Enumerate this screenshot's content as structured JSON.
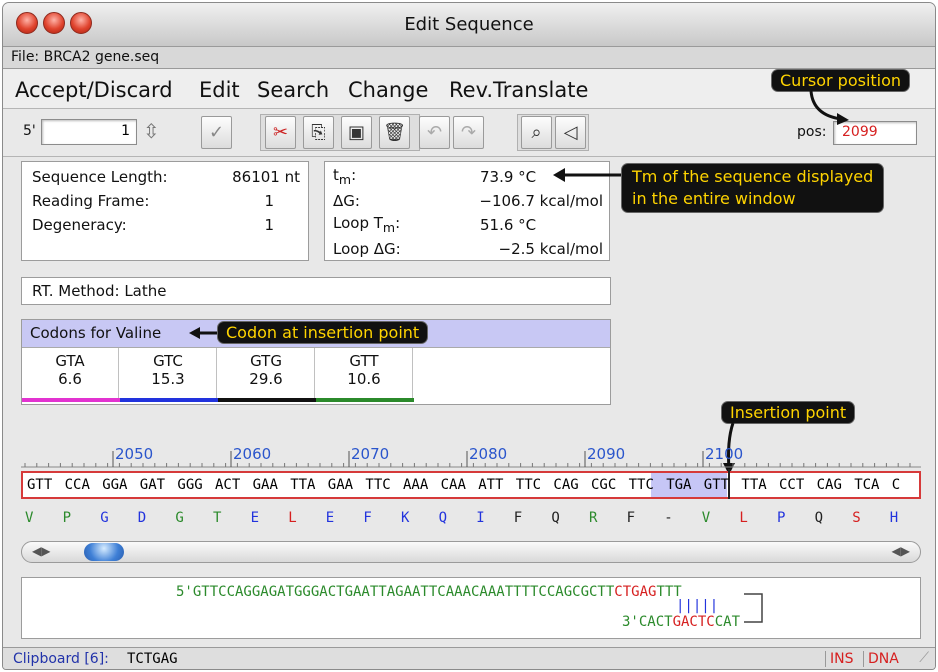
{
  "window": {
    "title": "Edit Sequence",
    "file": "File: BRCA2 gene.seq"
  },
  "menu": [
    "Accept/Discard",
    "Edit",
    "Search",
    "Change",
    "Rev.Translate"
  ],
  "toolbar": {
    "prime": "5'",
    "position_value": "1",
    "pos_label": "pos:",
    "pos_value": "2099"
  },
  "icons": {
    "stepper": "stepper-icon",
    "check": "check-icon",
    "cut": "scissors-icon",
    "copy": "copy-icon",
    "paste": "paste-icon",
    "trash": "trash-icon",
    "undo": "undo-icon",
    "redo": "redo-icon",
    "search": "search-icon",
    "speaker": "speaker-icon"
  },
  "info": {
    "length_label": "Sequence Length:",
    "length_value": "86101 nt",
    "frame_label": "Reading Frame:",
    "frame_value": "1",
    "degeneracy_label": "Degeneracy:",
    "degeneracy_value": "1"
  },
  "thermo": {
    "tm_label": "t",
    "tm_sub": "m",
    "tm_colon": ":",
    "tm_value": "73.9 °C",
    "dg_label": "ΔG:",
    "dg_value": "−106.7 kcal/mol",
    "looptm_label": "Loop T",
    "looptm_sub": "m",
    "looptm_colon": ":",
    "looptm_value": "51.6 °C",
    "loopdg_label": "Loop ΔG:",
    "loopdg_value": "−2.5 kcal/mol"
  },
  "method": "RT. Method: Lathe",
  "codons": {
    "header": "Codons for Valine",
    "items": [
      {
        "codon": "GTA",
        "value": "6.6",
        "color": "#e233d0"
      },
      {
        "codon": "GTC",
        "value": "15.3",
        "color": "#2233dd"
      },
      {
        "codon": "GTG",
        "value": "29.6",
        "color": "#111111"
      },
      {
        "codon": "GTT",
        "value": "10.6",
        "color": "#2b8a2b"
      }
    ]
  },
  "callouts": {
    "cursor": "Cursor position",
    "tm_line1": "Tm of the sequence displayed",
    "tm_line2": "in the entire window",
    "codon": "Codon at insertion point",
    "insertion": "Insertion point"
  },
  "ruler": {
    "labels": [
      "2050",
      "2060",
      "2070",
      "2080",
      "2090",
      "2100"
    ]
  },
  "sequence": {
    "codons": [
      "GTT",
      "CCA",
      "GGA",
      "GAT",
      "GGG",
      "ACT",
      "GAA",
      "TTA",
      "GAA",
      "TTC",
      "AAA",
      "CAA",
      "ATT",
      "TTC",
      "CAG",
      "CGC",
      "TTC",
      "TGA",
      "GTT",
      "TTA",
      "CCT",
      "CAG",
      "TCA",
      "C"
    ],
    "aminoacids": [
      {
        "aa": "V",
        "color": "#2b8a2b"
      },
      {
        "aa": "P",
        "color": "#2b8a2b"
      },
      {
        "aa": "G",
        "color": "#2233dd"
      },
      {
        "aa": "D",
        "color": "#2233dd"
      },
      {
        "aa": "G",
        "color": "#2b8a2b"
      },
      {
        "aa": "T",
        "color": "#2b8a2b"
      },
      {
        "aa": "E",
        "color": "#2233dd"
      },
      {
        "aa": "L",
        "color": "#d62020"
      },
      {
        "aa": "E",
        "color": "#2233dd"
      },
      {
        "aa": "F",
        "color": "#2233dd"
      },
      {
        "aa": "K",
        "color": "#2233dd"
      },
      {
        "aa": "Q",
        "color": "#2233dd"
      },
      {
        "aa": "I",
        "color": "#2233dd"
      },
      {
        "aa": "F",
        "color": "#222222"
      },
      {
        "aa": "Q",
        "color": "#222222"
      },
      {
        "aa": "R",
        "color": "#2b8a2b"
      },
      {
        "aa": "F",
        "color": "#222222"
      },
      {
        "aa": "-",
        "color": "#222222"
      },
      {
        "aa": "V",
        "color": "#2b8a2b"
      },
      {
        "aa": "L",
        "color": "#d62020"
      },
      {
        "aa": "P",
        "color": "#2233dd"
      },
      {
        "aa": "Q",
        "color": "#222222"
      },
      {
        "aa": "S",
        "color": "#d62020"
      },
      {
        "aa": "H",
        "color": "#2233dd"
      }
    ]
  },
  "hairpin": {
    "top_prefix": "5'GTTCCAGGAGATGGGACTGAATTAGAATTCAAACAAATTTTCCAGCGCTT",
    "top_stem": "CTGAG",
    "top_suffix": "TTT",
    "pairs": "|||||",
    "bottom_prefix": "3'CACT",
    "bottom_stem": "GACTC",
    "bottom_suffix": "CAT"
  },
  "status": {
    "clipboard_label": "Clipboard [6]:",
    "clipboard_value": "TCTGAG",
    "ins": "INS",
    "dna": "DNA"
  }
}
